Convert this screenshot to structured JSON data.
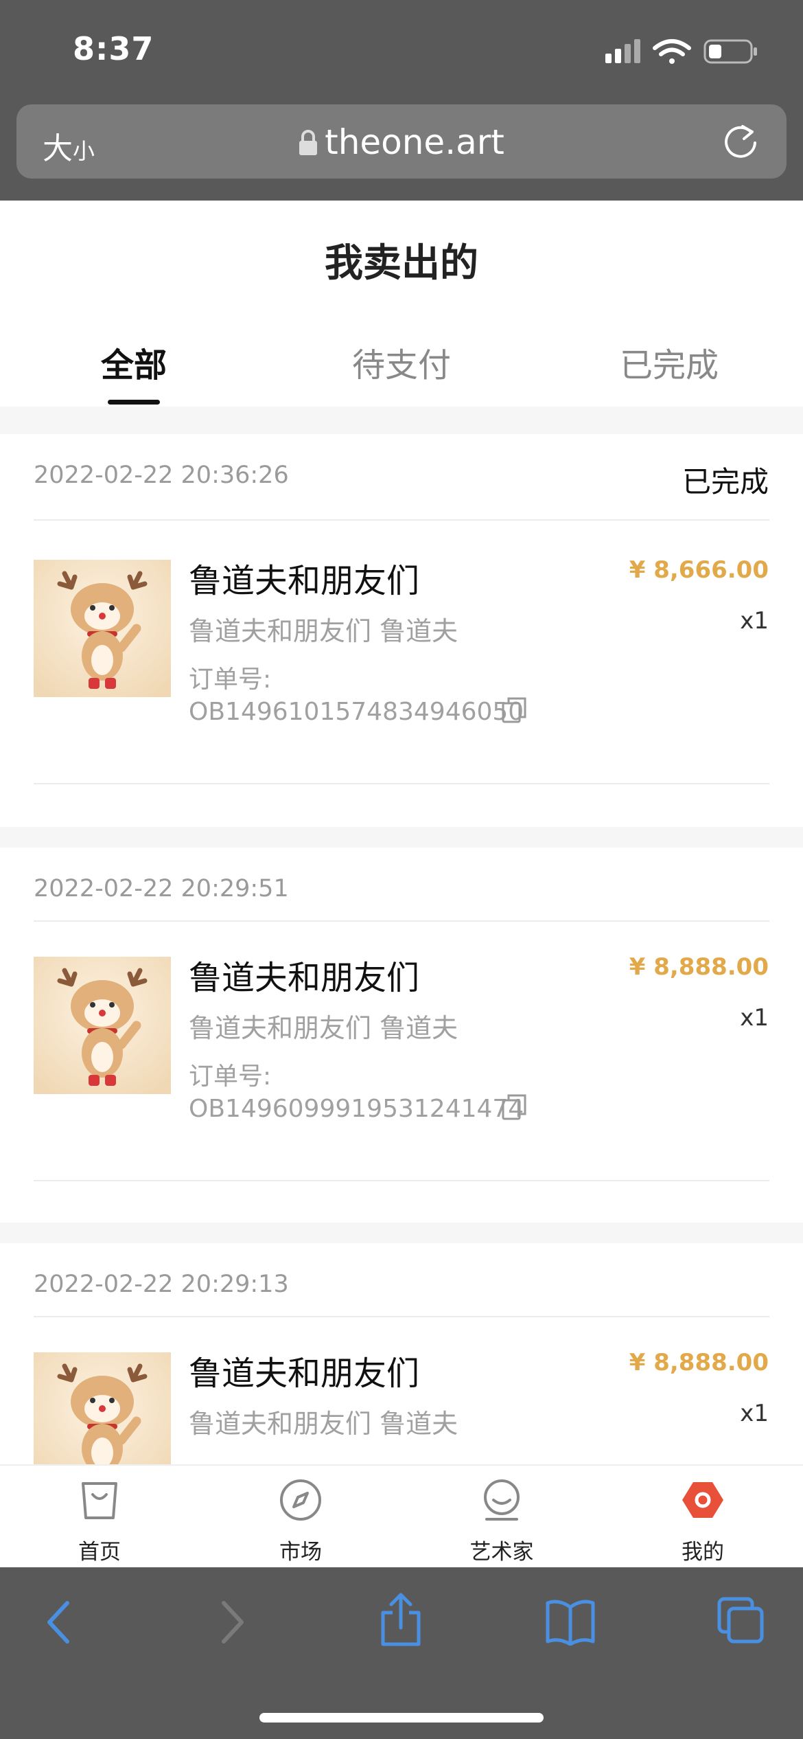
{
  "status_bar": {
    "time": "8:37"
  },
  "browser": {
    "text_size_big": "大",
    "text_size_small": "小",
    "url": "theone.art"
  },
  "page": {
    "title": "我卖出的",
    "tabs": [
      {
        "label": "全部",
        "active": true
      },
      {
        "label": "待支付",
        "active": false
      },
      {
        "label": "已完成",
        "active": false
      }
    ]
  },
  "orders": [
    {
      "time": "2022-02-22 20:36:26",
      "status": "已完成",
      "title": "鲁道夫和朋友们",
      "subtitle": "鲁道夫和朋友们 鲁道夫",
      "order_label": "订单号:",
      "order_no": "OB1496101574834946050",
      "price": "¥ 8,666.00",
      "qty": "x1"
    },
    {
      "time": "2022-02-22 20:29:51",
      "status": "",
      "title": "鲁道夫和朋友们",
      "subtitle": "鲁道夫和朋友们 鲁道夫",
      "order_label": "订单号:",
      "order_no": "OB1496099919531241474",
      "price": "¥ 8,888.00",
      "qty": "x1"
    },
    {
      "time": "2022-02-22 20:29:13",
      "status": "",
      "title": "鲁道夫和朋友们",
      "subtitle": "鲁道夫和朋友们 鲁道夫",
      "price": "¥ 8,888.00",
      "qty": "x1"
    }
  ],
  "app_tabs": [
    {
      "label": "首页",
      "icon": "shopping-bag-icon"
    },
    {
      "label": "市场",
      "icon": "compass-icon"
    },
    {
      "label": "艺术家",
      "icon": "artist-icon"
    },
    {
      "label": "我的",
      "icon": "profile-hexagon-icon"
    }
  ],
  "colors": {
    "price": "#e2a94a",
    "browser_chrome": "#595959",
    "toolbar_icon": "#4a90e2",
    "active_tab_icon": "#e8503a"
  }
}
